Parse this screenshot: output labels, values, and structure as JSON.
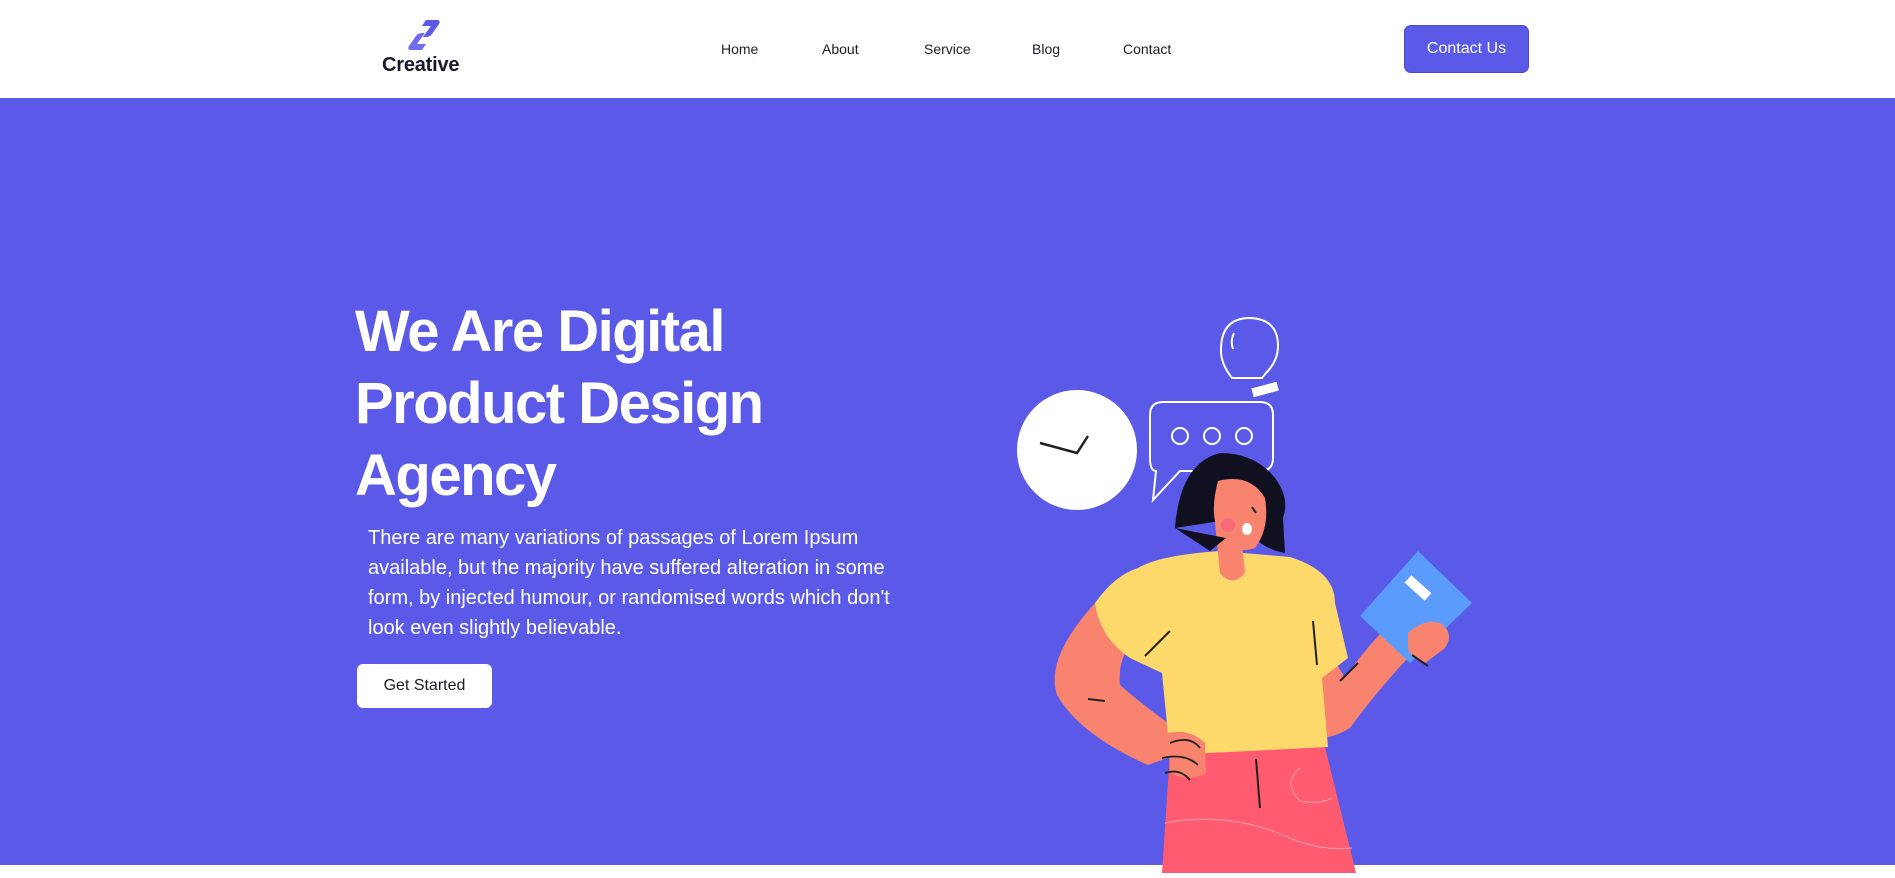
{
  "header": {
    "logo_text": "Creative",
    "nav": [
      "Home",
      "About",
      "Service",
      "Blog",
      "Contact"
    ],
    "contact_button": "Contact Us"
  },
  "hero": {
    "title": "We Are Digital Product Design Agency",
    "description": "There are many variations of passages of Lorem Ipsum available, but the majority have suffered alteration in some form, by injected humour, or randomised words which don't look even slightly believable.",
    "cta_button": "Get Started"
  },
  "colors": {
    "brand": "#5b59e8",
    "background": "#ffffff",
    "text_dark": "#141a2a"
  }
}
